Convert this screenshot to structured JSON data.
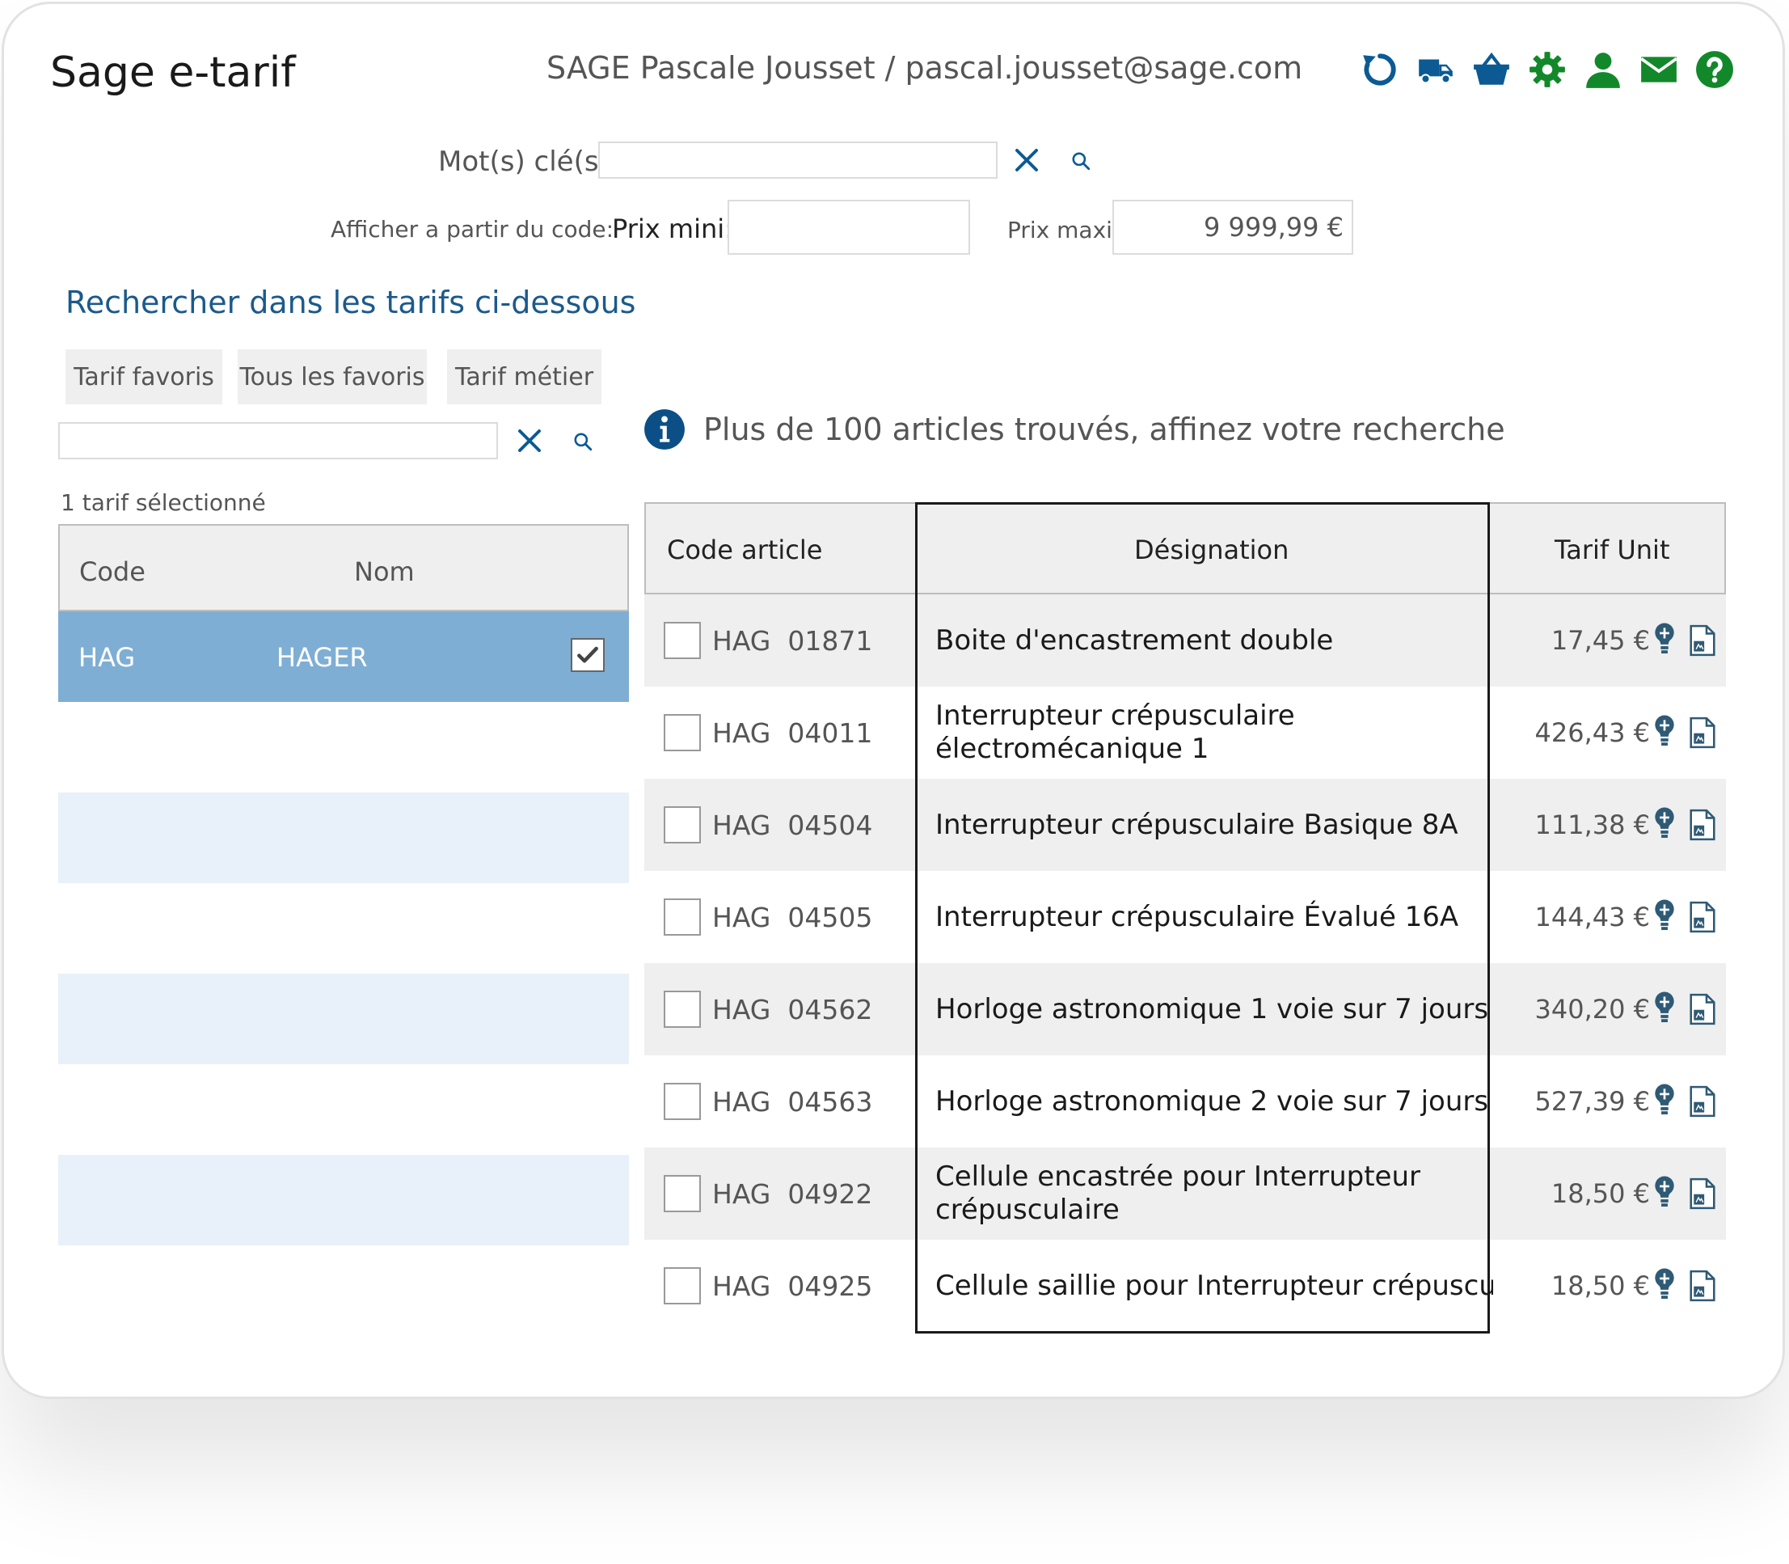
{
  "header": {
    "app_title": "Sage e-tarif",
    "user_info": "SAGE Pascale Jousset / pascal.jousset@sage.com",
    "icons": [
      {
        "name": "refresh-icon",
        "color": "#0b5a94"
      },
      {
        "name": "truck-icon",
        "color": "#0b5a94"
      },
      {
        "name": "basket-icon",
        "color": "#0b5a94"
      },
      {
        "name": "gear-icon",
        "color": "#12882a"
      },
      {
        "name": "user-icon",
        "color": "#12882a"
      },
      {
        "name": "mail-icon",
        "color": "#12882a"
      },
      {
        "name": "help-icon",
        "color": "#12882a"
      }
    ]
  },
  "search": {
    "keywords_label": "Mot(s) clé(s",
    "keywords_value": "",
    "from_code_label": "Afficher a partir du code:",
    "min_price_label": "Prix mini:",
    "min_price_value": "",
    "max_price_label": "Prix maxi",
    "max_price_value": "9 999,99 €"
  },
  "tariffs": {
    "section_title": "Rechercher dans les tarifs ci-dessous",
    "buttons": [
      "Tarif favoris",
      "Tous les favoris",
      "Tarif métier"
    ],
    "filter_value": "",
    "selected_count": "1 tarif sélectionné",
    "columns": {
      "code": "Code",
      "name": "Nom"
    },
    "rows": [
      {
        "code": "HAG",
        "name": "HAGER",
        "checked": true
      }
    ]
  },
  "results": {
    "info_message": "Plus de 100 articles trouvés, affinez votre recherche",
    "columns": {
      "code": "Code article",
      "designation": "Désignation",
      "price": "Tarif Unit"
    },
    "rows": [
      {
        "brand": "HAG",
        "code": "01871",
        "designation": [
          "Boite d'encastrement double"
        ],
        "price": "17,45 €"
      },
      {
        "brand": "HAG",
        "code": "04011",
        "designation": [
          "Interrupteur crépusculaire",
          "électromécanique 1"
        ],
        "price": "426,43 €"
      },
      {
        "brand": "HAG",
        "code": "04504",
        "designation": [
          "Interrupteur crépusculaire Basique 8A"
        ],
        "price": "111,38 €"
      },
      {
        "brand": "HAG",
        "code": "04505",
        "designation": [
          "Interrupteur crépusculaire Évalué 16A"
        ],
        "price": "144,43 €"
      },
      {
        "brand": "HAG",
        "code": "04562",
        "designation": [
          "Horloge astronomique 1 voie sur 7 jours"
        ],
        "price": "340,20 €"
      },
      {
        "brand": "HAG",
        "code": "04563",
        "designation": [
          "Horloge astronomique 2 voie sur 7 jours"
        ],
        "price": "527,39 €"
      },
      {
        "brand": "HAG",
        "code": "04922",
        "designation": [
          "Cellule encastrée pour Interrupteur",
          "crépusculaire"
        ],
        "price": "18,50 €"
      },
      {
        "brand": "HAG",
        "code": "04925",
        "designation": [
          "Cellule saillie pour Interrupteur crépusculaire"
        ],
        "price": "18,50 €"
      }
    ]
  }
}
